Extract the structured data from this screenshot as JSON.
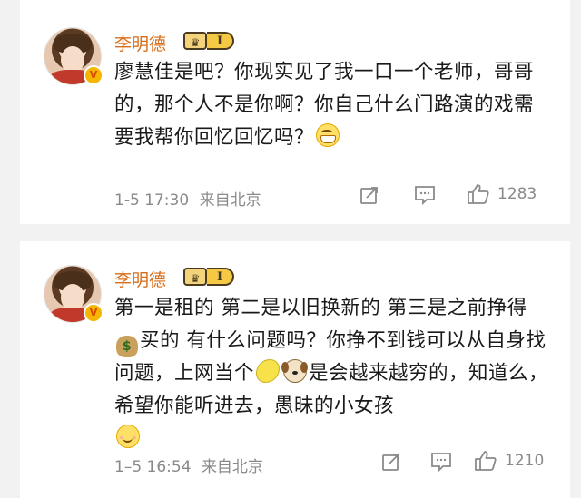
{
  "comments": [
    {
      "username": "李明德",
      "vip_level": "I",
      "verified_mark": "V",
      "text": "廖慧佳是吧？你现实见了我一口一个老师，哥哥的，那个人不是你啊？你自己什么门路演的戏需要我帮你回忆回忆吗？",
      "emoji": "grin-emoji",
      "time": "1-5 17:30",
      "source": "来自北京",
      "likes": "1283"
    },
    {
      "username": "李明德",
      "vip_level": "I",
      "verified_mark": "V",
      "text_a": "第一是租的 第二是以旧换新的 第三是之前挣得",
      "text_b": "买的 有什么问题吗？你挣不到钱可以从自身找问题，上网当个",
      "text_c": "是会越来越穷的，知道么，希望你能听进去，愚昧的小女孩",
      "emoji_money": "$",
      "emoji_money_name": "money-bag-emoji",
      "emoji_lemon_name": "lemon-emoji",
      "emoji_dog_name": "dog-emoji",
      "emoji_end": "smile-emoji",
      "time": "1–5 16:54",
      "source": "来自北京",
      "likes": "1210"
    }
  ],
  "icons": {
    "share": "share-icon",
    "comment": "comment-icon",
    "like": "like-icon"
  },
  "colors": {
    "username": "#d76d19",
    "meta": "#8a8a8a",
    "background": "#f2f2f2"
  }
}
